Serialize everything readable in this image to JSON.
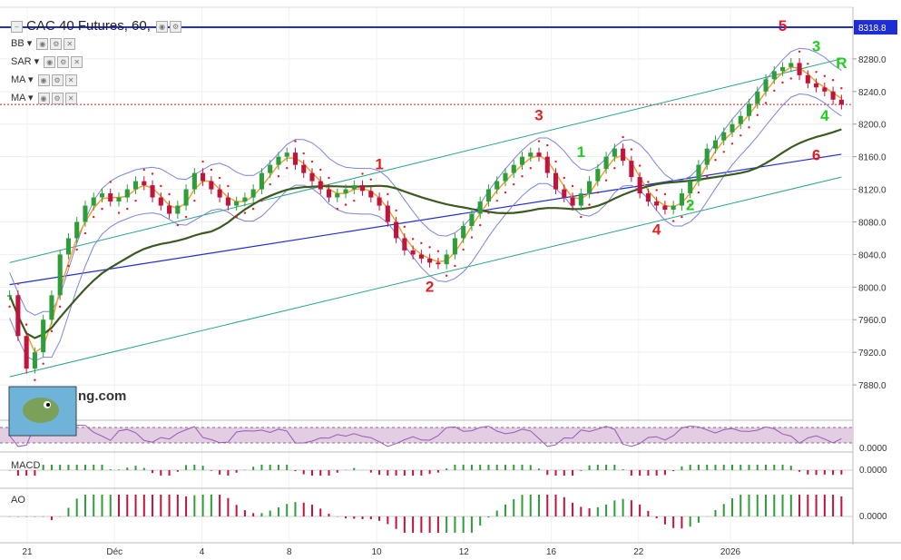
{
  "header": {
    "title": "CAC 40 Futures, 60,"
  },
  "indicators": [
    {
      "label": "BB"
    },
    {
      "label": "SAR"
    },
    {
      "label": "MA"
    },
    {
      "label": "MA"
    }
  ],
  "subpanes": {
    "rsi_value": "0.0000",
    "macd_label": "MACD",
    "macd_value": "0.0000",
    "ao_label": "AO",
    "ao_value": "0.0000"
  },
  "watermark": "ng.com",
  "chart_data": {
    "type": "candlestick",
    "y_range": [
      7840,
      8330
    ],
    "y_ticks": [
      8280.0,
      8240.0,
      8200.0,
      8160.0,
      8120.0,
      8080.0,
      8040.0,
      8000.0,
      7960.0,
      7920.0,
      7880.0
    ],
    "x_tick_labels": [
      "21",
      "Déc",
      "4",
      "8",
      "10",
      "12",
      "16",
      "22",
      "2026"
    ],
    "highlight_level": {
      "value": 8318.8,
      "label": "8318.8",
      "color": "#1f2dd6"
    },
    "price_line": {
      "value": 8224,
      "color": "#cc2222"
    },
    "price": [
      7990,
      7940,
      7900,
      7920,
      7960,
      7990,
      8040,
      8060,
      8080,
      8100,
      8110,
      8115,
      8105,
      8110,
      8120,
      8130,
      8125,
      8110,
      8100,
      8090,
      8100,
      8120,
      8140,
      8130,
      8120,
      8110,
      8100,
      8105,
      8110,
      8120,
      8140,
      8150,
      8160,
      8165,
      8150,
      8140,
      8130,
      8120,
      8110,
      8115,
      8120,
      8125,
      8118,
      8110,
      8100,
      8080,
      8060,
      8045,
      8040,
      8035,
      8030,
      8028,
      8040,
      8060,
      8075,
      8090,
      8105,
      8120,
      8130,
      8140,
      8150,
      8160,
      8165,
      8160,
      8140,
      8120,
      8110,
      8100,
      8115,
      8130,
      8145,
      8160,
      8170,
      8155,
      8135,
      8115,
      8105,
      8100,
      8095,
      8100,
      8115,
      8130,
      8150,
      8170,
      8180,
      8190,
      8200,
      8210,
      8225,
      8240,
      8255,
      8265,
      8270,
      8275,
      8260,
      8250,
      8245,
      8240,
      8230,
      8224
    ],
    "wave_labels": [
      {
        "text": "5",
        "color": "#e02020"
      },
      {
        "text": "3",
        "color": "#22cc22"
      },
      {
        "text": "R",
        "color": "#22cc22"
      },
      {
        "text": "4",
        "color": "#22cc22"
      },
      {
        "text": "3",
        "color": "#e02020"
      },
      {
        "text": "1",
        "color": "#22cc22"
      },
      {
        "text": "1",
        "color": "#e02020"
      },
      {
        "text": "2",
        "color": "#e02020"
      },
      {
        "text": "4",
        "color": "#e02020"
      },
      {
        "text": "2",
        "color": "#22cc22"
      },
      {
        "text": "6",
        "color": "#e02020"
      }
    ],
    "colors": {
      "bull": "#2e9e3a",
      "bear": "#c0143c",
      "bands": "#7a83e0",
      "sar": "#e02020",
      "ma_fast": "#f0a030",
      "ma_slow": "#3b5a1e",
      "channel": "#2aa58a",
      "trend": "#1f2dd6"
    }
  }
}
